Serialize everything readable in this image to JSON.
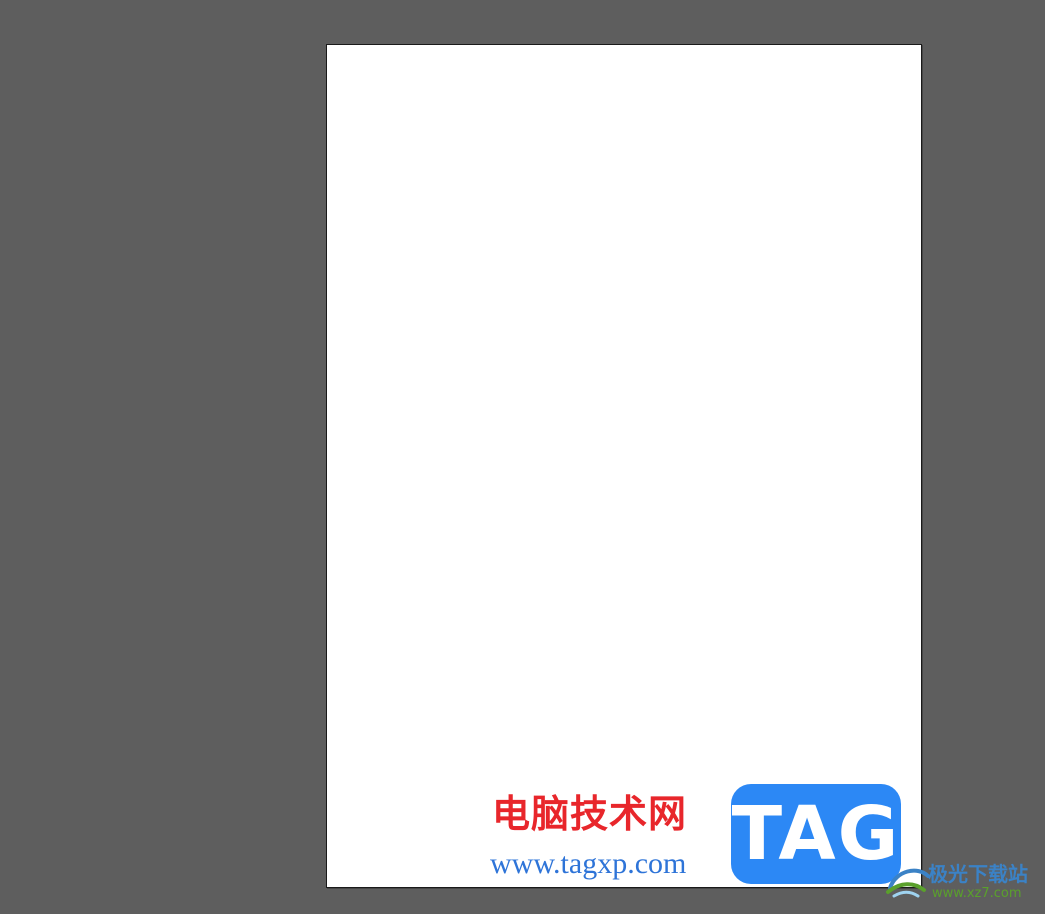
{
  "watermark": {
    "site_name": "电脑技术网",
    "site_url": "www.tagxp.com",
    "tag_text": "TAG",
    "xz_name": "极光下载站",
    "xz_url": "www.xz7.com"
  },
  "colors": {
    "workspace": "#5e5e5e",
    "artboard": "#ffffff",
    "site_name": "#e8262b",
    "site_url": "#2e74d8",
    "tag_bg": "#2c88f5",
    "xz_name": "#3b82c6",
    "xz_url": "#5aa02c"
  }
}
